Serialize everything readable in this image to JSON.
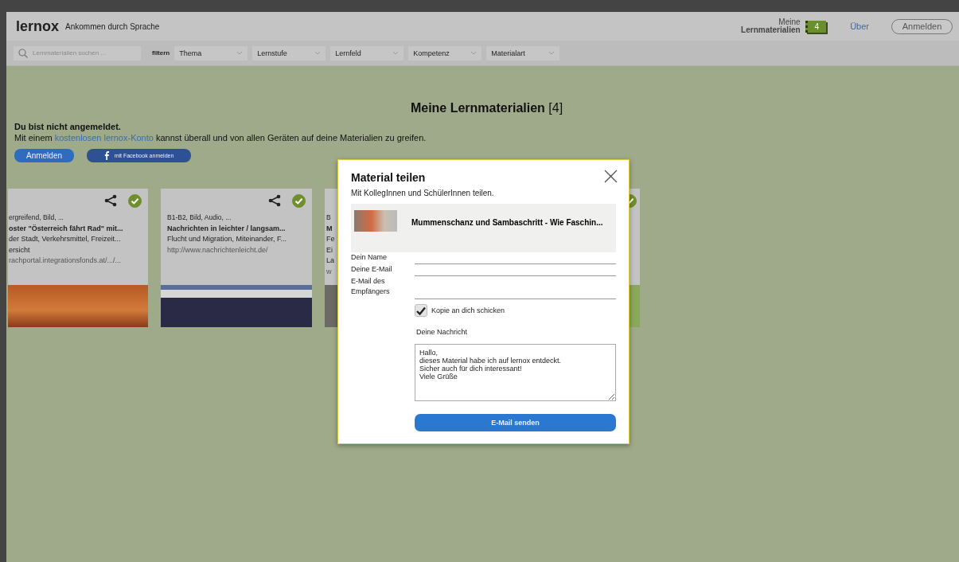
{
  "header": {
    "logo": "lernox",
    "tagline": "Ankommen durch Sprache",
    "my_materials": {
      "line_1": "Meine",
      "line_2": "Lernmaterialien",
      "count": "4"
    },
    "about_link": "Über",
    "login_button": "Anmelden"
  },
  "filter_bar": {
    "search": {
      "placeholder": "Lernmaterialien suchen ..."
    },
    "filter_label": "filtern",
    "dropdowns": [
      "Thema",
      "Lernstufe",
      "Lernfeld",
      "Kompetenz",
      "Materialart"
    ]
  },
  "page": {
    "title": "Meine Lernmaterialien",
    "count": "[4]",
    "notice_title": "Du bist nicht angemeldet.",
    "notice_before": "Mit einem",
    "notice_link": "kostenlosen lernox-Konto",
    "notice_after": "kannst überall und von allen Geräten auf deine Materialien zu greifen.",
    "login_button": "Anmelden",
    "facebook_button": "mit Facebook anmelden"
  },
  "cards": [
    {
      "saved": true,
      "lines": [
        {
          "kind": "meta",
          "text": "ergreifend, Bild, ..."
        },
        {
          "kind": "title",
          "text": "oster \"Österreich fährt Rad\" mit..."
        },
        {
          "kind": "plain",
          "text": "der Stadt, Verkehrsmittel, Freizeit..."
        },
        {
          "kind": "plain",
          "text": "ersicht"
        },
        {
          "kind": "url",
          "text": "rachportal.integrationsfonds.at/.../..."
        }
      ]
    },
    {
      "saved": true,
      "lines": [
        {
          "kind": "meta",
          "text": "B1-B2, Bild, Audio, ..."
        },
        {
          "kind": "title",
          "text": "Nachrichten in leichter / langsam..."
        },
        {
          "kind": "plain",
          "text": "Flucht und Migration, Miteinander, F..."
        },
        {
          "kind": "url",
          "text": "http://www.nachrichtenleicht.de/"
        }
      ]
    },
    {
      "lines": [
        {
          "kind": "meta",
          "text": "B"
        },
        {
          "kind": "title",
          "text": "M"
        },
        {
          "kind": "plain",
          "text": "Fe"
        },
        {
          "kind": "plain",
          "text": "Ei"
        },
        {
          "kind": "plain",
          "text": "La"
        },
        {
          "kind": "url",
          "text": "w"
        }
      ]
    },
    {
      "saved": true
    }
  ],
  "modal": {
    "title": "Material teilen",
    "subtitle": "Mit KollegInnen und SchülerInnen teilen.",
    "material_title": "Mummenschanz und Sambaschritt - Wie Faschin...",
    "fields": [
      {
        "label": "Dein Name",
        "kind": "single"
      },
      {
        "label": "Deine E-Mail",
        "kind": "single"
      },
      {
        "label": "E-Mail des Empfängers",
        "kind": "double"
      }
    ],
    "copy_checkbox": {
      "label": "Kopie an dich schicken",
      "checked": true
    },
    "message_label": "Deine Nachricht",
    "message": "Hallo,\ndieses Material habe ich auf lernox entdeckt.\nSicher auch für dich interessant!\nViele Grüße",
    "send_button": "E-Mail senden"
  }
}
